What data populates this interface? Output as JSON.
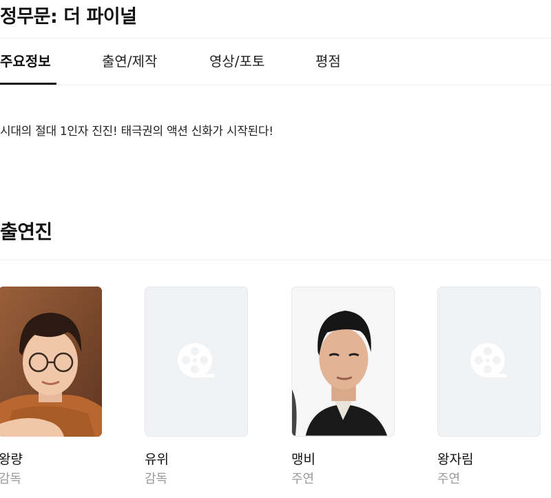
{
  "movie": {
    "title": "정무문: 더 파이널"
  },
  "tabs": [
    {
      "label": "주요정보",
      "active": true
    },
    {
      "label": "출연/제작",
      "active": false
    },
    {
      "label": "영상/포토",
      "active": false
    },
    {
      "label": "평점",
      "active": false
    }
  ],
  "synopsis": "시대의 절대 1인자 진진! 태극권의 액션 신화가 시작된다!",
  "cast_section": {
    "title": "출연진",
    "members": [
      {
        "name": "왕량",
        "role": "감독",
        "has_photo": true
      },
      {
        "name": "유위",
        "role": "감독",
        "has_photo": false
      },
      {
        "name": "맹비",
        "role": "주연",
        "has_photo": true
      },
      {
        "name": "왕자림",
        "role": "주연",
        "has_photo": false
      }
    ]
  },
  "colors": {
    "accent": "#111111",
    "muted_text": "#9a9a9a",
    "placeholder_bg": "#f1f2f4",
    "placeholder_icon": "#ffffff",
    "divider": "#ececec"
  },
  "icons": {
    "placeholder": "film-reel-icon"
  }
}
